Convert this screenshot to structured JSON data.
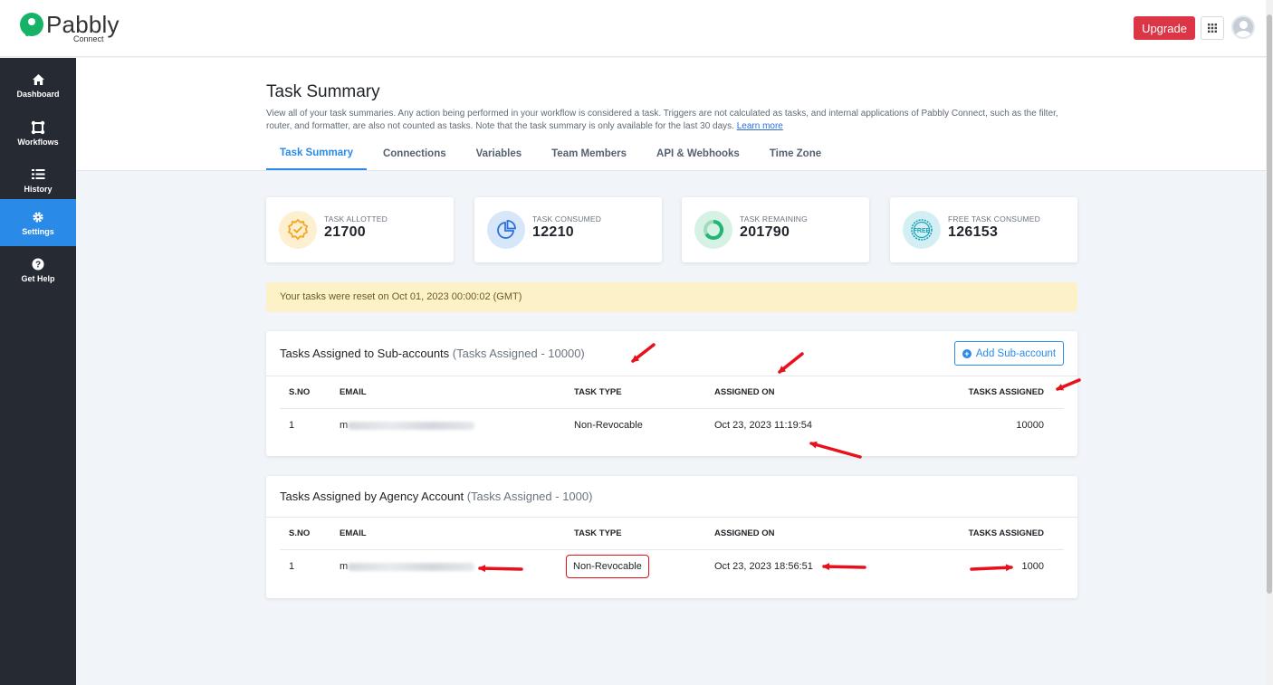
{
  "brand": {
    "name": "Pabbly",
    "sub": "Connect",
    "color": "#15b268"
  },
  "header": {
    "upgrade_label": "Upgrade"
  },
  "sidebar": {
    "items": [
      {
        "label": "Dashboard",
        "icon": "home-icon"
      },
      {
        "label": "Workflows",
        "icon": "workflow-icon"
      },
      {
        "label": "History",
        "icon": "history-icon"
      },
      {
        "label": "Settings",
        "icon": "gear-icon",
        "active": true
      },
      {
        "label": "Get Help",
        "icon": "question-icon"
      }
    ]
  },
  "page": {
    "title": "Task Summary",
    "description": "View all of your task summaries. Any action being performed in your workflow is considered a task. Triggers are not calculated as tasks, and internal applications of Pabbly Connect, such as the filter, router, and formatter, are also not counted as tasks. Note that the task summary is only available for the last 30 days.",
    "learn_more": "Learn more",
    "tabs": [
      {
        "label": "Task Summary",
        "active": true
      },
      {
        "label": "Connections"
      },
      {
        "label": "Variables"
      },
      {
        "label": "Team Members"
      },
      {
        "label": "API & Webhooks"
      },
      {
        "label": "Time Zone"
      }
    ]
  },
  "stats": [
    {
      "label": "TASK ALLOTTED",
      "value": "21700",
      "icon": "badge-check-icon",
      "color": "#f5a623"
    },
    {
      "label": "TASK CONSUMED",
      "value": "12210",
      "icon": "pie-chart-icon",
      "color": "#2a6fdb"
    },
    {
      "label": "TASK REMAINING",
      "value": "201790",
      "icon": "ring-progress-icon",
      "color": "#22b573"
    },
    {
      "label": "FREE TASK CONSUMED",
      "value": "126153",
      "icon": "free-badge-icon",
      "color": "#1aa3b8"
    }
  ],
  "notice": "Your tasks were reset on Oct 01, 2023 00:00:02 (GMT)",
  "sub_accounts": {
    "title": "Tasks Assigned to Sub-accounts",
    "count_label": "(Tasks Assigned - 10000)",
    "add_label": "Add Sub-account",
    "columns": [
      "S.NO",
      "EMAIL",
      "TASK TYPE",
      "ASSIGNED ON",
      "TASKS ASSIGNED"
    ],
    "rows": [
      {
        "sno": "1",
        "email_prefix": "m",
        "type": "Non-Revocable",
        "assigned_on": "Oct 23, 2023 11:19:54",
        "tasks": "10000"
      }
    ]
  },
  "agency": {
    "title": "Tasks Assigned by Agency Account",
    "count_label": "(Tasks Assigned - 1000)",
    "columns": [
      "S.NO",
      "EMAIL",
      "TASK TYPE",
      "ASSIGNED ON",
      "TASKS ASSIGNED"
    ],
    "rows": [
      {
        "sno": "1",
        "email_prefix": "m",
        "type": "Non-Revocable",
        "assigned_on": "Oct 23, 2023 18:56:51",
        "tasks": "1000"
      }
    ]
  }
}
